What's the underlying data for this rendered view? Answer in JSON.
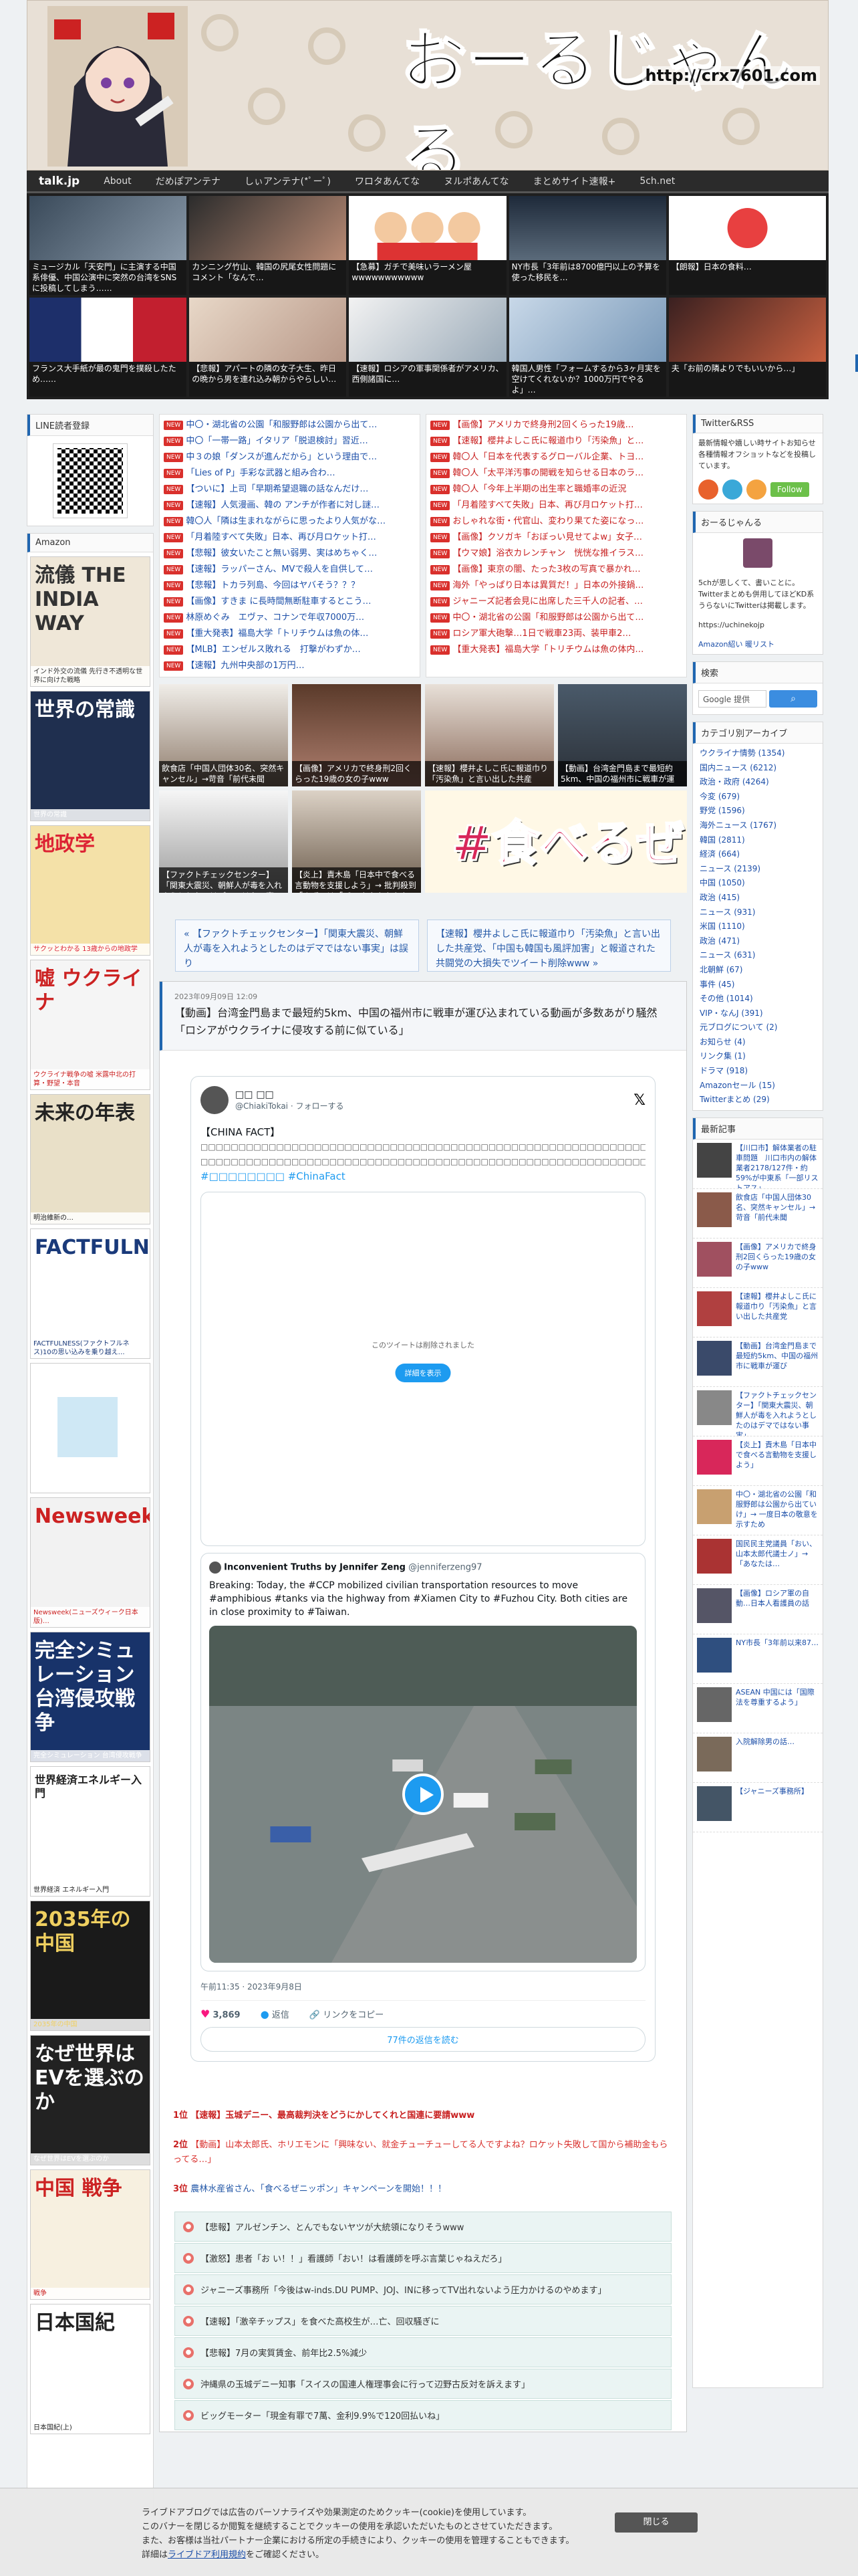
{
  "header": {
    "site_title": "おーるじゃんる",
    "site_url": "http://crx7601.com"
  },
  "nav": {
    "brand": "talk.jp",
    "items": [
      "About",
      "だめぽアンテナ",
      "しぃアンテナ(*ﾟーﾟ)",
      "ワロタあんてな",
      "ヌルポあんてな",
      "まとめサイト速報+",
      "5ch.net"
    ]
  },
  "thumbs": [
    "ミュージカル「天安門」に主演する中国系俳優、中国公演中に突然の台湾をSNSに投稿してしまう……",
    "カンニング竹山、韓国の尻尾女性問題にコメント「なんで…",
    "【急募】ガチで美味いラーメン屋wwwwwwwwwww",
    "NY市長「3年前は8700億円以上の予算を使った移民を…",
    "【朗報】日本の食料…",
    "フランス大手紙が最の鬼門を撲殺したため……",
    "【悲報】アパートの隣の女子大生、昨日の晩から男を連れ込み朝からやらしい…",
    "【速報】ロシアの軍事関係者がアメリカ、西側諸国に…",
    "韓国人男性「フォームするから3ヶ月実を空けてくれないか？1000万円でやるよ」…",
    "夫「お前の隣よりでもいいから…」"
  ],
  "left": {
    "line_title": "LINE読者登録",
    "amazon_title": "Amazon",
    "books": [
      {
        "title": "流儀 THE INDIA WAY",
        "caption": "インド外交の流儀 先行き不透明な世界に向けた戦略"
      },
      {
        "title": "世界の常識",
        "caption": "世界の常識"
      },
      {
        "title": "地政学",
        "caption": "サクッとわかる 13歳からの地政学"
      },
      {
        "title": "嘘 ウクライナ",
        "caption": "ウクライナ戦争の嘘 米露中北の打算・野望・本音"
      },
      {
        "title": "未来の年表",
        "caption": "明治維新の…"
      },
      {
        "title": "FACTFULNESS",
        "caption": "FACTFULNESS(ファクトフルネス)10の思い込みを乗り越え…"
      },
      {
        "title": "",
        "caption": ""
      },
      {
        "title": "Newsweek",
        "caption": "Newsweek(ニューズウィーク日本版)…"
      },
      {
        "title": "完全シミュレーション 台湾侵攻戦争",
        "caption": "完全シミュレーション 台湾侵攻戦争"
      },
      {
        "title": "世界経済エネルギー入門",
        "caption": "世界経済 エネルギー入門"
      },
      {
        "title": "2035年の中国",
        "caption": "2035年の中国"
      },
      {
        "title": "なぜ世界はEVを選ぶのか",
        "caption": "なぜ世界はEVを選ぶのか"
      },
      {
        "title": "中国 戦争",
        "caption": "戦争"
      },
      {
        "title": "日本国紀",
        "caption": "日本国紀(上)"
      }
    ]
  },
  "headlines_left": [
    {
      "text": "中〇・湖北省の公園「和服野郎は公園から出て…",
      "red": false
    },
    {
      "text": "中〇「一帯一路」イタリア「脱退検討」習近…",
      "red": false
    },
    {
      "text": "中３の娘「ダンスが進んだから」という理由で…",
      "red": false
    },
    {
      "text": "「Lies of P」手彩な武器と組み合わ…",
      "red": false
    },
    {
      "text": "【ついに】上司「早期希望退職の話なんだけ…",
      "red": false
    },
    {
      "text": "【速報】人気漫画、韓の アンチが作者に対し謎…",
      "red": false
    },
    {
      "text": "韓〇人「隣は生まれながらに思ったより人気がな…",
      "red": false
    },
    {
      "text": "「月着陸すべて失敗」日本、再び月ロケット打…",
      "red": false
    },
    {
      "text": "【悲報】彼女いたこと無い弱男、実はめちゃく…",
      "red": false
    },
    {
      "text": "【速報】ラッパーさん、MVで殺人を自供して…",
      "red": false
    },
    {
      "text": "【悲報】トカラ列島、今回はヤバそう？？？",
      "red": false
    },
    {
      "text": "【画像】すきま に長時間無断駐車するとこう…",
      "red": false
    },
    {
      "text": "林原めぐみ　エヴァ、コナンで年収7000万…",
      "red": false
    },
    {
      "text": "【重大発表】福島大学「トリチウムは魚の体…",
      "red": false
    },
    {
      "text": "【MLB】エンゼルス敗れる　打撃がわずか…",
      "red": false
    },
    {
      "text": "【速報】九州中央部の1万円…",
      "red": false
    }
  ],
  "headlines_right": [
    {
      "text": "【画像】アメリカで終身刑2回くらった19歳…",
      "red": true
    },
    {
      "text": "【速報】櫻井よしこ氏に報道巾り「汚染魚」と…",
      "red": true
    },
    {
      "text": "韓〇人「日本を代表するグローバル企業、トヨ…",
      "red": true
    },
    {
      "text": "韓〇人「太平洋汚事の開戦を知らせる日本のラ…",
      "red": true
    },
    {
      "text": "韓〇人「今年上半期の出生率と職婚率の近況",
      "red": true
    },
    {
      "text": "「月着陸すべて失敗」日本、再び月ロケット打…",
      "red": true
    },
    {
      "text": "おしゃれな街・代官山、変わり果てた姿になっ…",
      "red": true
    },
    {
      "text": "【画像】クソガキ「おぼっい見せてよw」女子…",
      "red": true
    },
    {
      "text": "【ウマ娘】浴衣カレンチャン　恍恍な推イラス…",
      "red": true
    },
    {
      "text": "【画像】東京の闇、たった3枚の写真で暴かれ…",
      "red": true
    },
    {
      "text": "海外「やっぱり日本は異質だ！」日本の外接鍋…",
      "red": true
    },
    {
      "text": "ジャニーズ記者会見に出席した三千人の記者、…",
      "red": true
    },
    {
      "text": "中〇・湖北省の公園「和服野郎は公園から出て…",
      "red": true
    },
    {
      "text": "ロシア軍大砲撃…1日で戦車23両、装甲車2…",
      "red": true
    },
    {
      "text": "【重大発表】福島大学「トリチウムは魚の体内…",
      "red": true
    }
  ],
  "pics": [
    {
      "caption": "飲食店「中国人団体30名、突然キャンセル」→苛音「前代未聞"
    },
    {
      "caption": "【画像】アメリカで終身刑2回くらった19歳の女の子www"
    },
    {
      "caption": "【速報】櫻井よしこ氏に報道巾り「汚染魚」と言い出した共産"
    },
    {
      "caption": "【動画】台湾金門島まで最短約5km、中国の福州市に戦車が運"
    },
    {
      "caption": "【ファクトチェックセンター】「関東大震災、朝鮮人が毒を入れようとしたのはデマではない事実」は誤り"
    },
    {
      "caption": "【炎上】責木島「日本中で食べる言動物を支援しよう」→ 批判殺到「まず」は「ギャオオオオオオン"
    }
  ],
  "wide_pic_text": "#食べるぜ",
  "prevnext": {
    "prev": "« 【ファクトチェックセンター】「関東大震災、朝鮮人が毒を入れようとしたのはデマではない事実」は誤り",
    "next": "【速報】櫻井よしこ氏に報道巾り「汚染魚」と言い出した共産党、「中国も韓国も風評加害」と報道された共闘党の大損失でツイート削除www »"
  },
  "article": {
    "date": "2023年09月09日 12:09",
    "title": "【動画】台湾金門島まで最短約5km、中国の福州市に戦車が運び込まれている動画が多数あがり騒然「ロシアがウクライナに侵攻する前に似ている」"
  },
  "tweet": {
    "name": "□□ □□",
    "handle": "@ChiakiTokai · フォローする",
    "heading": "【CHINA FACT】",
    "line1": "□□□□□□□□□□□□□□□□□□□□□□□□□□□□□□□□□□□□□□□□□□□□□□□□□□□□□□□□□□□□",
    "line2": "□□□□□□□□□□□□□□□□□□□□□□□□□□□□□□□□□□□□□□□□□□□□□□□□□□□□□□□□□□□□…",
    "hashtags": "#□□□□□□□□ #ChinaFact",
    "quote_msg": "このツイートは削除されました",
    "quote_btn": "詳細を表示",
    "q2_name": "Inconvenient Truths by Jennifer Zeng",
    "q2_handle": "@jenniferzeng97",
    "q2_body": "Breaking:  Today, the #CCP mobilized civilian transportation resources to move #amphibious #tanks via the highway from #Xiamen City to #Fuzhou City. Both cities are in close proximity to #Taiwan.",
    "time": "午前11:35 · 2023年9月8日",
    "likes": "3,869",
    "reply": "返信",
    "copy": "リンクをコピー",
    "more": "77件の返信を読む"
  },
  "ranks": [
    {
      "no": "1位",
      "text": "【速報】玉城デニー、最高裁判決をどうにかしてくれと国連に要請www",
      "cls": "r"
    },
    {
      "no": "2位",
      "text": "【動画】山本太郎氏、ホリエモンに「興味ない、就金チューチューしてる人ですよね？ロケット失敗して国から補助金もらってる…」",
      "cls": "s"
    },
    {
      "no": "3位",
      "text": "農林水産省さん、「食べるぜニッポン」キャンペーンを開始！！！",
      "cls": "bl"
    }
  ],
  "related": [
    "【悲報】アルゼンチン、とんでもないヤツが大統領になりそうwww",
    "【激怒】患者「お い！！」看護師「おい！は看護師を呼ぶ言葉じゃねえだろ」",
    "ジャニーズ事務所「今後はw-inds.DU PUMP、JOJ、INに移ってTV出れないよう圧力かけるのやめます」",
    "【速報】「激辛チップス」を食べた高校生が…亡、回収騒ぎに",
    "【悲報】7月の実質賃金、前年比2.5%減少",
    "沖縄県の玉城デニー知事「スイスの国連人権理事会に行って辺野古反対を訴えます」",
    "ビッグモーター「現金有罪で7萬、金利9.9%で120回払いね」"
  ],
  "right": {
    "twitter_title": "Twitter&RSS",
    "twitter_text": "最新情報や嬉しい時サイトお知らせ各種情報オフショットなどを投稿しています。",
    "follow": "Follow",
    "about_title": "おーるじゃんる",
    "about_text": "5chが思しくて、書いことに。Twitterまとめも併用してほどKD系うらないにTwitterは掲載します。",
    "about_url": "https://uchinekojp",
    "about_link": "Amazon紹い 暖リスト",
    "search_title": "検索",
    "search_placeholder": "Google 提供",
    "search_btn": "検索",
    "cat_title": "カテゴリ別アーカイブ",
    "cats": [
      "ウクライナ情勢 (1354)",
      "国内ニュース (6212)",
      "政治・政府 (4264)",
      "今変 (679)",
      "野党 (1596)",
      "海外ニュース (1767)",
      "韓国 (2811)",
      "経済 (664)",
      "ニュース (2139)",
      "中国 (1050)",
      "政治 (415)",
      "ニュース (931)",
      "米国 (1110)",
      "政治 (471)",
      "ニュース (631)",
      "北朝鮮 (67)",
      "事件 (45)",
      "その他 (1014)",
      "VIP・なんJ (391)",
      "元ブログについて (2)",
      "お知らせ (4)",
      "リンク集 (1)",
      "ドラマ (918)",
      "Amazonセール (15)",
      "Twitterまとめ (29)"
    ],
    "recent_title": "最新記事",
    "recent": [
      "【川口市】解体業者の駐車問題　川口市内の解体業者2178/127件・約59%が中東系「一部リストアス」",
      "飲食店「中国人団体30名、突然キャンセル」→苛音「前代未聞",
      "【画像】アメリカで終身刑2回くらった19歳の女の子www",
      "【速報】櫻井よしこ氏に報道巾り「汚染魚」と言い出した共産党",
      "【動画】台湾金門島まで最短約5km、中国の福州市に戦車が運び",
      "【ファクトチェックセンター】「関東大震災、朝鮮人が毒を入れようとしたのはデマではない事実」",
      "【炎上】責木島「日本中で食べる言動物を支援しよう」",
      "中〇・湖北省の公園「和服野郎は公園から出ていけ」→ 一度日本の敬意を示すため",
      "国民民主党議員「おい、山本太郎代議士ノ」→ 「あなたは…",
      "【画像】ロシア軍の自動…日本人看護員の話",
      "NY市長「3年前以来87…",
      "ASEAN 中国には「国際法を尊重するよう」",
      "入院解除男の話…",
      "【ジャニーズ事務所】"
    ]
  },
  "cookie": {
    "line1": "ライブドアブログでは広告のパーソナライズや効果測定のためクッキー(cookie)を使用しています。",
    "line2": "このバナーを閉じるか閲覧を継続することでクッキーの使用を承認いただいたものとさせていただきます。",
    "line3": "また、お客様は当社パートナー企業における所定の手続きにより、クッキーの使用を管理することもできます。",
    "line4_pre": "詳細は",
    "line4_link": "ライブドア利用規約",
    "line4_post": "をご確認ください。",
    "close": "閉じる"
  }
}
